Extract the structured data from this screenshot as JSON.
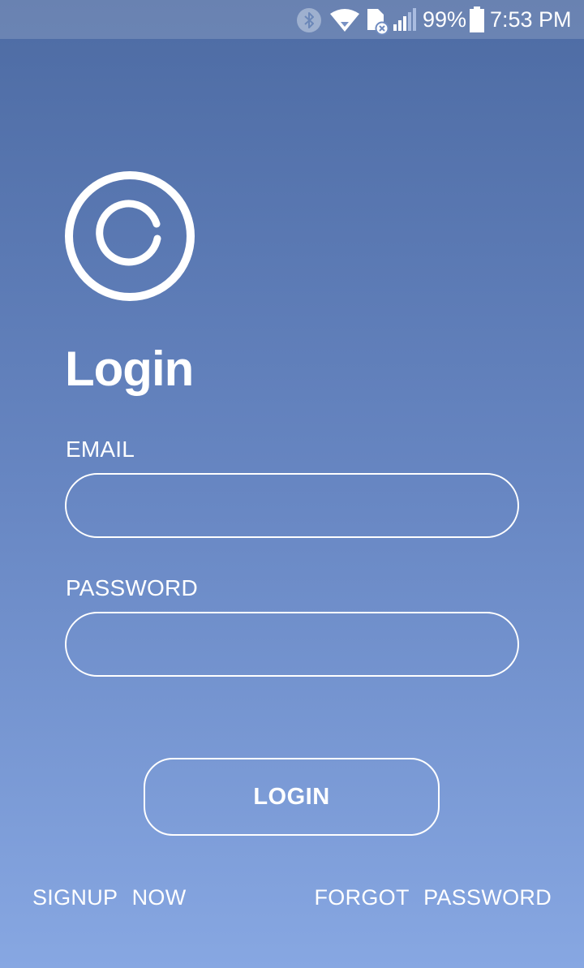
{
  "status_bar": {
    "icons": [
      "bluetooth-icon",
      "wifi-icon",
      "sim-card-icon",
      "signal-icon",
      "battery-icon"
    ],
    "battery": "99%",
    "time": "7:53 PM"
  },
  "logo": {
    "icon": "copyright-icon"
  },
  "title": "Login",
  "email": {
    "label": "EMAIL",
    "value": "",
    "placeholder": ""
  },
  "password": {
    "label": "PASSWORD",
    "value": "",
    "placeholder": ""
  },
  "login_button": "LOGIN",
  "footer": {
    "signup": "SIGNUP NOW",
    "forgot": "FORGOT PASSWORD"
  },
  "colors": {
    "gradient_top": "#4d6ba3",
    "gradient_bottom": "#87a7e2",
    "foreground": "#ffffff"
  }
}
